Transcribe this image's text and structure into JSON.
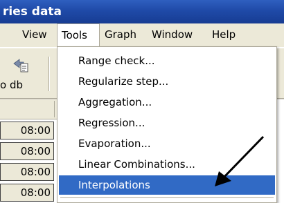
{
  "window": {
    "title": "ries data"
  },
  "menubar": {
    "items": [
      {
        "label": "View"
      },
      {
        "label": "Tools"
      },
      {
        "label": "Graph"
      },
      {
        "label": "Window"
      },
      {
        "label": "Help"
      }
    ]
  },
  "toolbar": {
    "button_label": "o db",
    "button_icon": "database-icon"
  },
  "grid": {
    "times": [
      "08:00",
      "08:00",
      "08:00",
      "08:00"
    ]
  },
  "tools_menu": {
    "items": [
      {
        "label": "Range check..."
      },
      {
        "label": "Regularize step..."
      },
      {
        "label": "Aggregation..."
      },
      {
        "label": "Regression..."
      },
      {
        "label": "Evaporation..."
      },
      {
        "label": "Linear Combinations..."
      },
      {
        "label": "Interpolations"
      }
    ],
    "highlighted_index": 6,
    "highlight_color": "#316ac5"
  },
  "annotation": {
    "icon": "pointer-arrow-icon",
    "color": "#000000"
  }
}
